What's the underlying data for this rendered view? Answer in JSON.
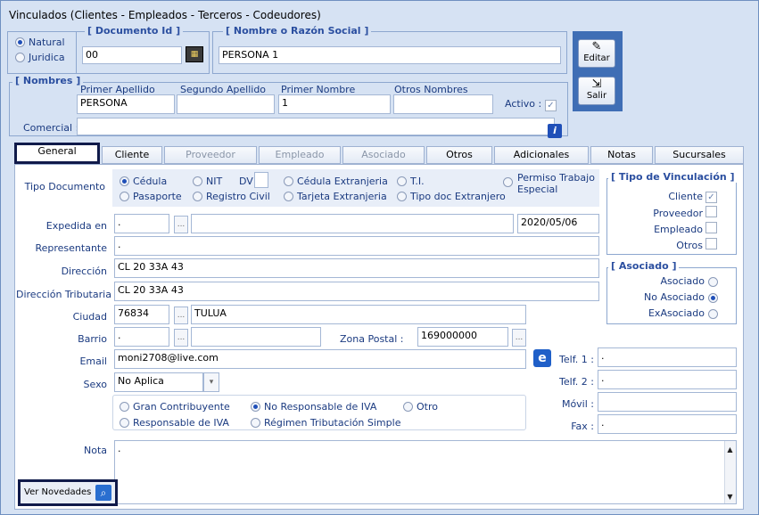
{
  "window_title": "Vinculados   (Clientes - Empleados - Terceros - Codeudores)",
  "persona": {
    "natural": "Natural",
    "juridica": "Juridica"
  },
  "documento": {
    "legend": "Documento Id",
    "value": "00"
  },
  "nombre": {
    "legend": "Nombre o Razón Social",
    "value": "PERSONA 1"
  },
  "buttons": {
    "editar": "Editar",
    "salir": "Salir",
    "ver_novedades": "Ver Novedades"
  },
  "nombres": {
    "legend": "Nombres",
    "primer_apellido_label": "Primer Apellido",
    "primer_apellido": "PERSONA",
    "segundo_apellido_label": "Segundo Apellido",
    "segundo_apellido": "",
    "primer_nombre_label": "Primer Nombre",
    "primer_nombre": "1",
    "otros_nombres_label": "Otros Nombres",
    "otros_nombres": "",
    "activo_label": "Activo :",
    "comercial_label": "Comercial :",
    "comercial": ""
  },
  "tabs": [
    "General",
    "Cliente",
    "Proveedor",
    "Empleado",
    "Asociado",
    "Otros",
    "Adicionales",
    "Notas",
    "Sucursales"
  ],
  "general": {
    "tipo_documento_label": "Tipo Documento",
    "tipos": {
      "cedula": "Cédula",
      "nit": "NIT",
      "dv": "DV",
      "cedula_ext": "Cédula Extranjeria",
      "ti": "T.I.",
      "permiso": "Permiso Trabajo Especial",
      "pasaporte": "Pasaporte",
      "registro_civil": "Registro Civil",
      "tarjeta_ext": "Tarjeta Extranjeria",
      "tipo_doc_ext": "Tipo doc Extranjero"
    },
    "expedida_label": "Expedida en",
    "expedida_code": ".",
    "expedida_fecha": "2020/05/06",
    "representante_label": "Representante",
    "representante": ".",
    "direccion_label": "Dirección",
    "direccion": "CL 20 33A  43",
    "direccion_trib_label": "Dirección Tributaria",
    "direccion_trib": "CL 20 33A 43",
    "ciudad_label": "Ciudad",
    "ciudad_code": "76834",
    "ciudad_name": "TULUA",
    "barrio_label": "Barrio",
    "barrio_code": ".",
    "zona_postal_label": "Zona Postal :",
    "zona_postal": "169000000",
    "email_label": "Email",
    "email": "moni2708@live.com",
    "sexo_label": "Sexo",
    "sexo": "No Aplica",
    "iva": {
      "gran": "Gran Contribuyente",
      "no_resp": "No Responsable de IVA",
      "otro": "Otro",
      "resp": "Responsable de IVA",
      "regimen": "Régimen Tributación Simple"
    },
    "telf1_label": "Telf. 1 :",
    "telf1": ".",
    "telf2_label": "Telf. 2 :",
    "telf2": ".",
    "movil_label": "Móvil :",
    "movil": "",
    "fax_label": "Fax :",
    "fax": ".",
    "nota_label": "Nota",
    "nota": "."
  },
  "vinculacion": {
    "legend": "Tipo de Vinculación",
    "cliente": "Cliente",
    "proveedor": "Proveedor",
    "empleado": "Empleado",
    "otros": "Otros"
  },
  "asociado": {
    "legend": "Asociado",
    "asociado": "Asociado",
    "no_asociado": "No Asociado",
    "exasociado": "ExAsociado"
  },
  "colors": {
    "accent": "#1f4fb8",
    "tab_selected_border": "#101a4a"
  }
}
